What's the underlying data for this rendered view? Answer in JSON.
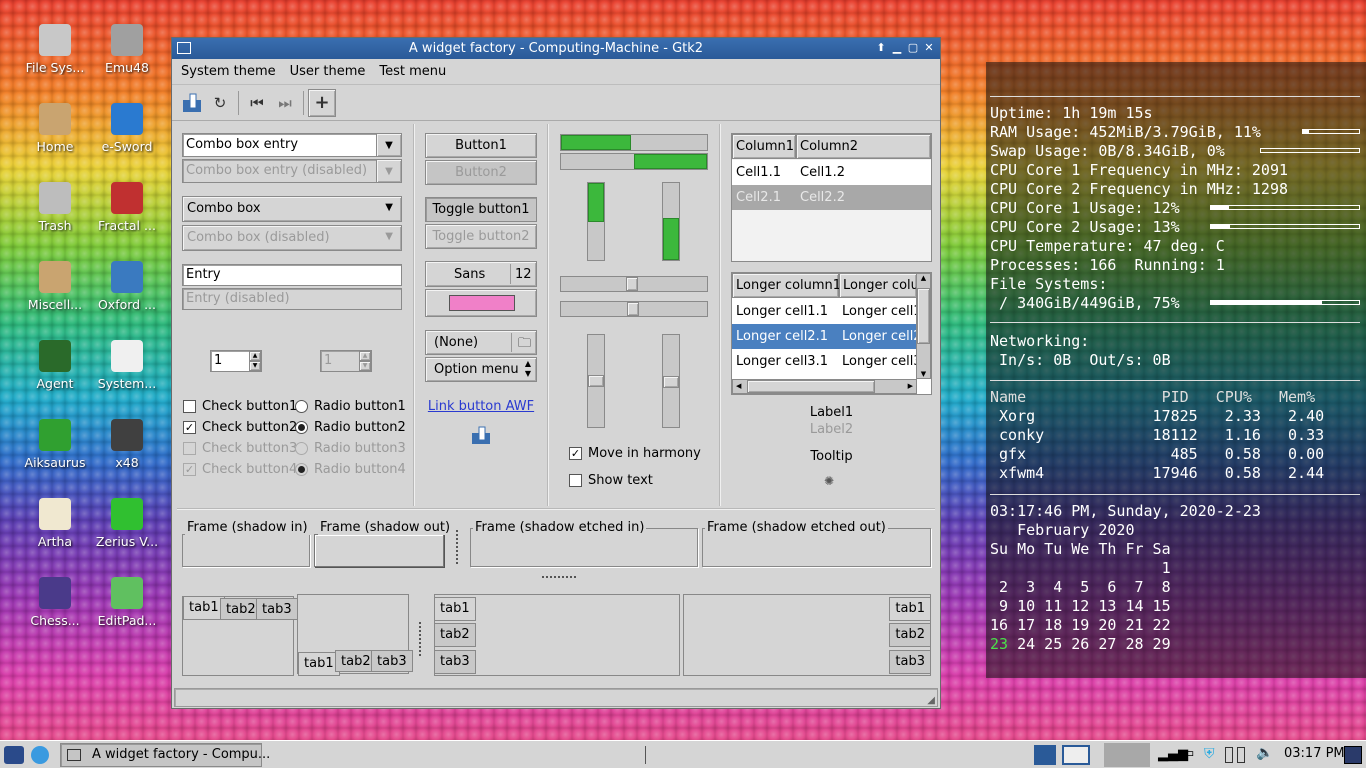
{
  "desktop": {
    "icons": [
      {
        "label": "File Sys...",
        "icon": "computer-icon",
        "color": "#c8c8c8"
      },
      {
        "label": "Emu48",
        "icon": "calculator-icon",
        "color": "#a0a0a0"
      },
      {
        "label": "Home",
        "icon": "home-folder-icon",
        "color": "#c9a470"
      },
      {
        "label": "e-Sword",
        "icon": "esword-icon",
        "color": "#2a7ad0"
      },
      {
        "label": "Trash",
        "icon": "trash-icon",
        "color": "#bdbdbd"
      },
      {
        "label": "Fractal ...",
        "icon": "fractal-icon",
        "color": "#c03030"
      },
      {
        "label": "Miscell...",
        "icon": "folder-icon",
        "color": "#c9a470"
      },
      {
        "label": "Oxford ...",
        "icon": "oxford-icon",
        "color": "#3a7ac0"
      },
      {
        "label": "Agent",
        "icon": "agent-icon",
        "color": "#2a6a2a"
      },
      {
        "label": "System...",
        "icon": "abc-icon",
        "color": "#f0f0f0"
      },
      {
        "label": "Aiksaurus",
        "icon": "aiksaurus-icon",
        "color": "#30a030"
      },
      {
        "label": "x48",
        "icon": "x48-icon",
        "color": "#404040"
      },
      {
        "label": "Artha",
        "icon": "book-icon",
        "color": "#f0e8d0"
      },
      {
        "label": "Zerius V...",
        "icon": "zerius-icon",
        "color": "#30c030"
      },
      {
        "label": "Chess...",
        "icon": "chess-icon",
        "color": "#4a3a8a"
      },
      {
        "label": "EditPad...",
        "icon": "editpad-icon",
        "color": "#60c060"
      }
    ]
  },
  "window": {
    "title": "A widget factory - Computing-Machine - Gtk2"
  },
  "menu": {
    "items": [
      "System theme",
      "User theme",
      "Test menu"
    ]
  },
  "col1": {
    "combo_entry": "Combo box entry",
    "combo_entry_dis": "Combo box entry (disabled)",
    "combo": "Combo box",
    "combo_dis": "Combo box (disabled)",
    "entry": "Entry",
    "entry_dis": "Entry (disabled)",
    "spin1": "1",
    "spin2": "1",
    "check1": "Check button1",
    "check2": "Check button2",
    "check3": "Check button3",
    "check4": "Check button4",
    "radio1": "Radio button1",
    "radio2": "Radio button2",
    "radio3": "Radio button3",
    "radio4": "Radio button4"
  },
  "col2": {
    "button1": "Button1",
    "button2": "Button2",
    "toggle1": "Toggle button1",
    "toggle2": "Toggle button2",
    "font_name": "Sans",
    "font_size": "12",
    "file": "(None)",
    "option": "Option menu",
    "link": "Link button AWF"
  },
  "col3": {
    "progress": [
      0.48,
      0.5,
      0.5,
      0.55
    ],
    "harmony": "Move in harmony",
    "show_text": "Show text"
  },
  "col4": {
    "tree1": {
      "headers": [
        "Column1",
        "Column2"
      ],
      "rows": [
        [
          "Cell1.1",
          "Cell1.2"
        ],
        [
          "Cell2.1",
          "Cell2.2"
        ]
      ]
    },
    "tree2": {
      "headers": [
        "Longer column1",
        "Longer colu"
      ],
      "rows": [
        [
          "Longer cell1.1",
          "Longer cell1"
        ],
        [
          "Longer cell2.1",
          "Longer cell2"
        ],
        [
          "Longer cell3.1",
          "Longer cell3"
        ]
      ]
    },
    "label1": "Label1",
    "label2": "Label2",
    "tooltip": "Tooltip"
  },
  "frames": [
    "Frame (shadow in)",
    "Frame (shadow out)",
    "Frame (shadow etched in)",
    "Frame (shadow etched out)"
  ],
  "tabs": [
    "tab1",
    "tab2",
    "tab3"
  ],
  "conky": {
    "uptime": "Uptime: 1h 19m 15s",
    "ram": "RAM Usage: 452MiB/3.79GiB, 11%",
    "ram_pct": 0.11,
    "swap": "Swap Usage: 0B/8.34GiB, 0%",
    "swap_pct": 0.0,
    "cpu1f": "CPU Core 1 Frequency in MHz: 2091",
    "cpu2f": "CPU Core 2 Frequency in MHz: 1298",
    "cpu1u": "CPU Core 1 Usage: 12%",
    "cpu1_pct": 0.12,
    "cpu2u": "CPU Core 2 Usage: 13%",
    "cpu2_pct": 0.13,
    "temp": "CPU Temperature: 47 deg. C",
    "procs": "Processes: 166  Running: 1",
    "fs": "File Systems:",
    "fsroot": " / 340GiB/449GiB, 75%",
    "fs_pct": 0.75,
    "net": "Networking:",
    "netio": " In/s: 0B  Out/s: 0B",
    "proc_header": "Name               PID   CPU%   Mem%",
    "proc_rows": [
      " Xorg             17825   2.33   2.40",
      " conky            18112   1.16   0.33",
      " gfx                485   0.58   0.00",
      " xfwm4            17946   0.58   2.44"
    ],
    "datetime": "03:17:46 PM, Sunday, 2020-2-23",
    "cal_title": "   February 2020",
    "cal_days": "Su Mo Tu We Th Fr Sa",
    "cal_rows": [
      "                   1",
      " 2  3  4  5  6  7  8",
      " 9 10 11 12 13 14 15",
      "16 17 18 19 20 21 22"
    ],
    "cal_today": "23",
    "cal_last": " 24 25 26 27 28 29"
  },
  "taskbar": {
    "task": "A widget factory - Compu...",
    "clock": "03:17 PM"
  }
}
